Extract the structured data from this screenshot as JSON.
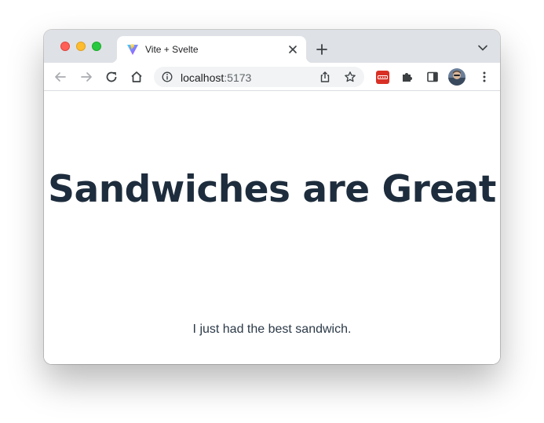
{
  "browser": {
    "tab": {
      "title": "Vite + Svelte",
      "favicon": "vite-logo-icon",
      "close_icon": "close-icon"
    },
    "new_tab_icon": "plus-icon",
    "tab_menu_icon": "chevron-down-icon",
    "toolbar": {
      "back_icon": "arrow-left-icon",
      "forward_icon": "arrow-right-icon",
      "reload_icon": "reload-icon",
      "home_icon": "home-icon",
      "omnibox": {
        "info_icon": "info-icon",
        "host": "localhost",
        "port": ":5173",
        "share_icon": "share-icon",
        "bookmark_icon": "star-icon"
      },
      "extension_icon": "password-manager-icon",
      "extensions_menu_icon": "puzzle-icon",
      "side_panel_icon": "side-panel-icon",
      "profile_icon": "avatar",
      "menu_icon": "kebab-menu-icon"
    },
    "colors": {
      "tabstrip": "#dee1e6",
      "traffic_red": "#ff5f57",
      "traffic_yellow": "#febc2e",
      "traffic_green": "#28c840",
      "extension_red": "#d93025"
    }
  },
  "page": {
    "heading": "Sandwiches are Great",
    "paragraph": "I just had the best sandwich.",
    "text_color": "#1e2d3d"
  }
}
